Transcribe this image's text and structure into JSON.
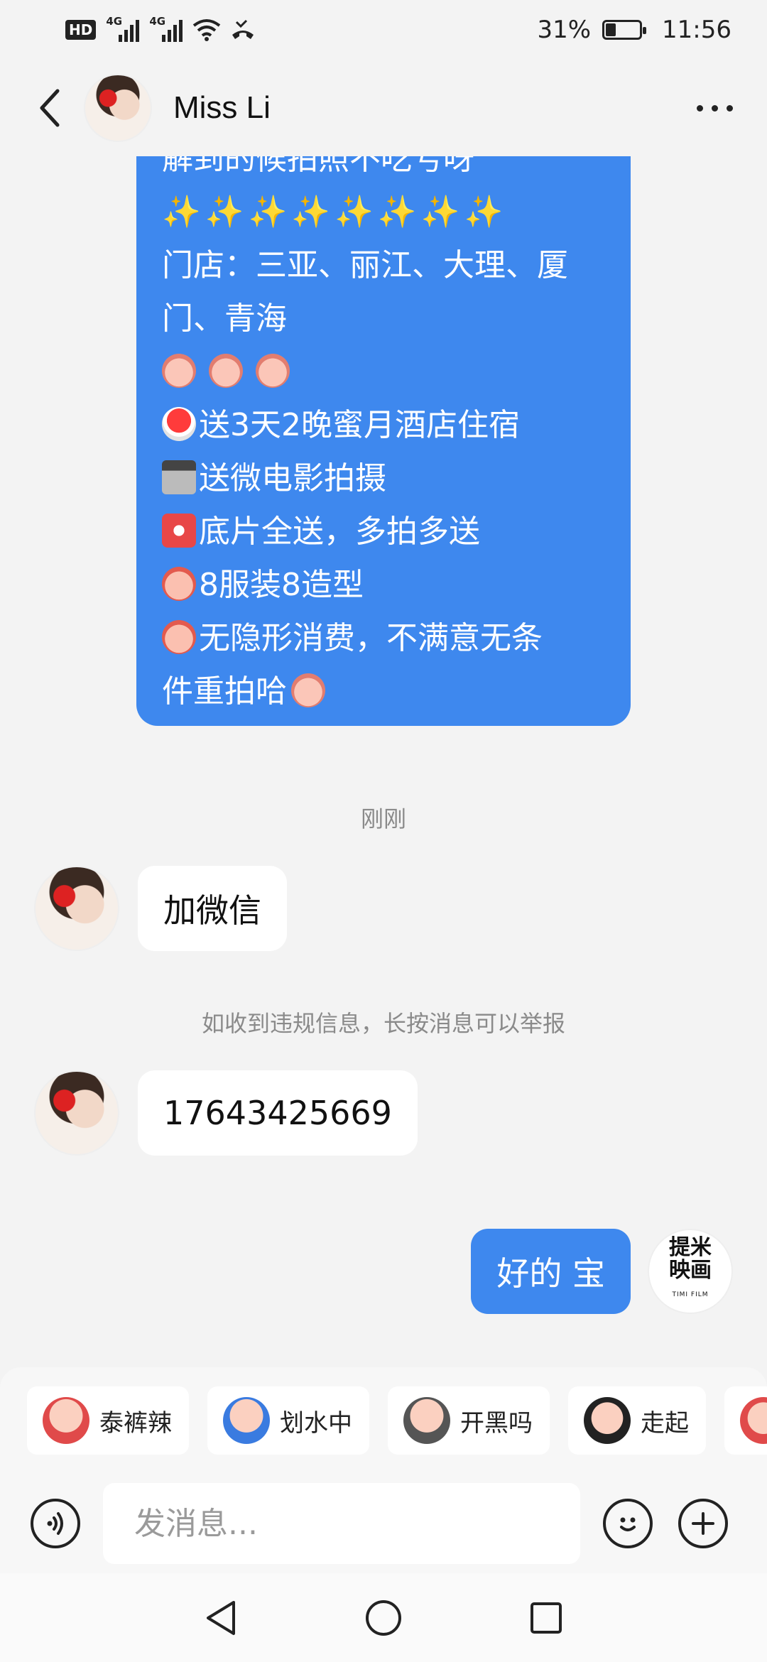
{
  "status_bar": {
    "hd_label": "HD",
    "net1": "4G",
    "net2": "4G",
    "battery_percent": "31%",
    "battery_level": 0.31,
    "time": "11:56"
  },
  "header": {
    "contact_name": "Miss Li",
    "back_icon": "chevron-left-icon",
    "more_icon": "more-horizontal-icon"
  },
  "messages": {
    "promo": {
      "line_cut": "解到的候拍照不吃亏呀",
      "sparkles": "✨✨✨✨✨✨✨✨",
      "stores_1": "门店：三亚、丽江、大理、厦",
      "stores_2": "门、青海",
      "item1": "送3天2晚蜜月酒店住宿",
      "item2": "送微电影拍摄",
      "item3": "底片全送，多拍多送",
      "item4": "8服装8造型",
      "item5_1": "无隐形消费，不满意无条",
      "item5_2": "件重拍哈"
    },
    "timestamp": "刚刚",
    "incoming_1": "加微信",
    "notice": "如收到违规信息，长按消息可以举报",
    "incoming_2": "17643425669",
    "outgoing_1": "好的 宝",
    "my_avatar_line1": "提米",
    "my_avatar_line2": "映画",
    "my_avatar_sub": "TIMI FILM"
  },
  "quick_stickers": [
    {
      "label": "泰裤辣"
    },
    {
      "label": "划水中"
    },
    {
      "label": "开黑吗"
    },
    {
      "label": "走起"
    },
    {
      "label": ""
    }
  ],
  "input": {
    "placeholder": "发消息..."
  },
  "colors": {
    "accent_blue": "#3e88ee",
    "background": "#f3f3f3"
  }
}
